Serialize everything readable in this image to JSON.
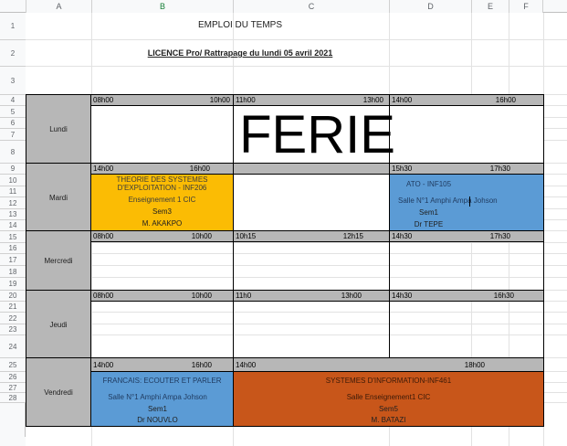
{
  "columns": [
    "A",
    "B",
    "C",
    "D",
    "E",
    "F"
  ],
  "rows": [
    "1",
    "2",
    "3",
    "4",
    "5",
    "6",
    "7",
    "8",
    "9",
    "10",
    "11",
    "12",
    "13",
    "14",
    "15",
    "16",
    "17",
    "18",
    "19",
    "20",
    "21",
    "22",
    "23",
    "24",
    "25",
    "26",
    "27",
    "28"
  ],
  "title": "EMPLOI DU TEMPS",
  "subtitle": "LICENCE Pro/ Rattrapage du lundi 05 avril 2021",
  "colors": {
    "yellow": "#fbbc04",
    "blue": "#5b9bd5",
    "orange": "#c8561a",
    "gray": "#b7b7b7"
  },
  "days": {
    "lundi": {
      "label": "Lundi",
      "slots": [
        [
          "08h00",
          "10h00"
        ],
        [
          "11h00",
          "13h00"
        ],
        [
          "14h00",
          "16h00"
        ]
      ],
      "ferie": "FERIE"
    },
    "mardi": {
      "label": "Mardi",
      "slots": [
        [
          "14h00",
          "16h00"
        ],
        [
          "",
          ""
        ],
        [
          "15h30",
          "17h30"
        ]
      ],
      "course1": {
        "line1": "THEORIE DES SYSTEMES",
        "line2": "D'EXPLOITATION - INF206",
        "room": "Enseignement 1 CIC",
        "sem": "Sem3",
        "prof": "M. AKAKPO"
      },
      "course2": {
        "title": "ATO - INF105",
        "room": "Salle N°1 Amphi Ampa Johson",
        "sem": "Sem1",
        "prof": "Dr TEPE"
      }
    },
    "mercredi": {
      "label": "Mercredi",
      "slots": [
        [
          "08h00",
          "10h00"
        ],
        [
          "10h15",
          "12h15"
        ],
        [
          "14h30",
          "17h30"
        ]
      ]
    },
    "jeudi": {
      "label": "Jeudi",
      "slots": [
        [
          "08h00",
          "10h00"
        ],
        [
          "11h0",
          "13h00"
        ],
        [
          "14h30",
          "16h30"
        ]
      ]
    },
    "vendredi": {
      "label": "Vendredi",
      "slots": [
        [
          "14h00",
          "16h00"
        ],
        [
          "14h00",
          "18h00"
        ]
      ],
      "course1": {
        "title": "FRANCAIS: ECOUTER ET PARLER",
        "room": "Salle N°1 Amphi Ampa Johson",
        "sem": "Sem1",
        "prof": "Dr NOUVLO"
      },
      "course2": {
        "title": "SYSTEMES D'INFORMATION-INF461",
        "room": "Salle Enseignement1 CIC",
        "sem": "Sem5",
        "prof": "M. BATAZI"
      }
    }
  }
}
